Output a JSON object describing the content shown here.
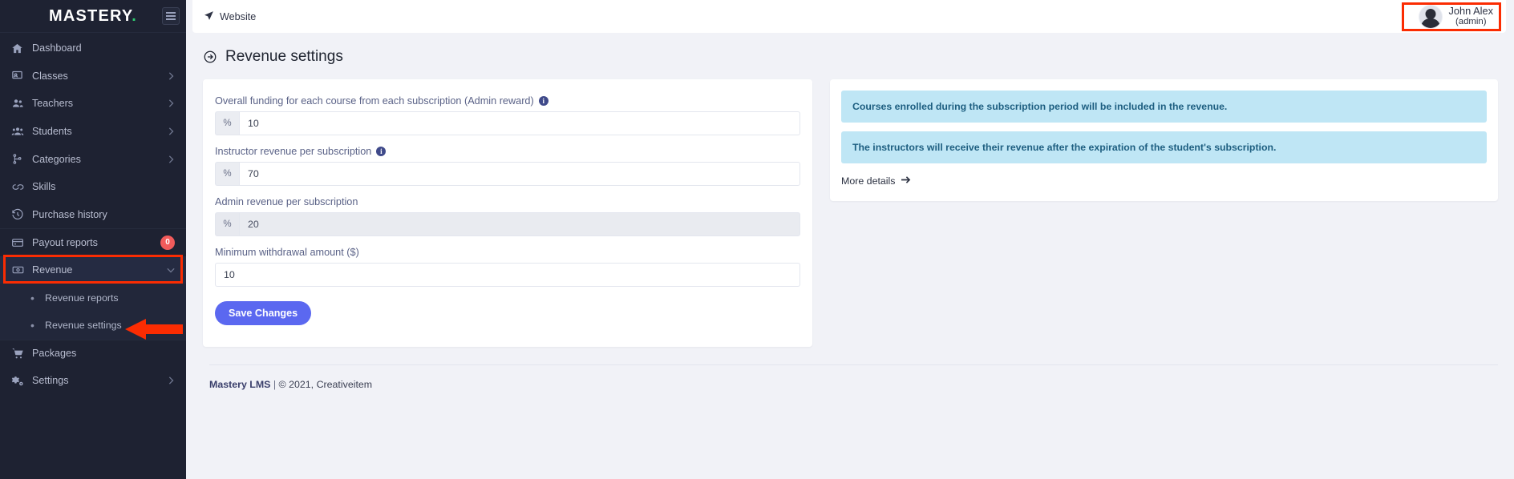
{
  "brand": {
    "name": "MASTERY",
    "dot": ".",
    "accent": "#2ecc71"
  },
  "sidebar": {
    "items": [
      {
        "label": "Dashboard",
        "icon": "home-icon",
        "chevron": false,
        "badge": null
      },
      {
        "label": "Classes",
        "icon": "classes-icon",
        "chevron": true,
        "badge": null
      },
      {
        "label": "Teachers",
        "icon": "teachers-icon",
        "chevron": true,
        "badge": null
      },
      {
        "label": "Students",
        "icon": "students-icon",
        "chevron": true,
        "badge": null
      },
      {
        "label": "Categories",
        "icon": "categories-icon",
        "chevron": true,
        "badge": null
      },
      {
        "label": "Skills",
        "icon": "skills-icon",
        "chevron": false,
        "badge": null
      },
      {
        "label": "Purchase history",
        "icon": "history-icon",
        "chevron": false,
        "badge": null
      },
      {
        "label": "Payout reports",
        "icon": "card-icon",
        "chevron": false,
        "badge": "0"
      },
      {
        "label": "Revenue",
        "icon": "money-icon",
        "chevron": true,
        "badge": null
      }
    ],
    "subitems": [
      {
        "label": "Revenue reports"
      },
      {
        "label": "Revenue settings"
      }
    ],
    "items_after": [
      {
        "label": "Packages",
        "icon": "cart-icon",
        "chevron": false,
        "badge": null
      },
      {
        "label": "Settings",
        "icon": "gears-icon",
        "chevron": true,
        "badge": null
      }
    ],
    "highlight_color": "#fb2c02"
  },
  "topbar": {
    "website_label": "Website",
    "user_name": "John Alex",
    "user_role": "(admin)"
  },
  "page": {
    "title": "Revenue settings"
  },
  "form": {
    "fields": [
      {
        "label": "Overall funding for each course from each subscription (Admin reward)",
        "has_info": true,
        "addon": "%",
        "value": "10",
        "readonly": false
      },
      {
        "label": "Instructor revenue per subscription",
        "has_info": true,
        "addon": "%",
        "value": "70",
        "readonly": false
      },
      {
        "label": "Admin revenue per subscription",
        "has_info": false,
        "addon": "%",
        "value": "20",
        "readonly": true
      },
      {
        "label": "Minimum withdrawal amount ($)",
        "has_info": false,
        "addon": null,
        "value": "10",
        "readonly": false
      }
    ],
    "save_label": "Save Changes"
  },
  "info_panel": {
    "alerts": [
      "Courses enrolled during the subscription period will be included in the revenue.",
      "The instructors will receive their revenue after the expiration of the student's subscription."
    ],
    "more_details_label": "More details",
    "alert_bg": "#bfe6f5",
    "alert_text": "#1d5e80"
  },
  "footer": {
    "brand": "Mastery LMS",
    "separator": " | ",
    "copyright": "© 2021, Creativeitem"
  }
}
